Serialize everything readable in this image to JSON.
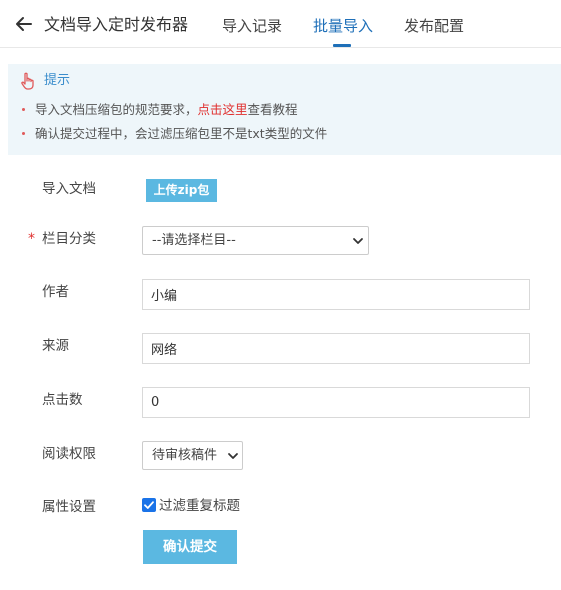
{
  "header": {
    "title": "文档导入定时发布器",
    "tabs": [
      {
        "label": "导入记录",
        "active": false
      },
      {
        "label": "批量导入",
        "active": true
      },
      {
        "label": "发布配置",
        "active": false
      }
    ]
  },
  "tip": {
    "title": "提示",
    "line1_prefix": "导入文档压缩包的规范要求，",
    "line1_link": "点击这里",
    "line1_suffix": "查看教程",
    "line2": "确认提交过程中，会过滤压缩包里不是txt类型的文件"
  },
  "form": {
    "upload_label": "导入文档",
    "upload_button": "上传zip包",
    "required_mark": "*",
    "category_label": "栏目分类",
    "category_value": "--请选择栏目--",
    "author_label": "作者",
    "author_value": "小编",
    "source_label": "来源",
    "source_value": "网络",
    "clicks_label": "点击数",
    "clicks_value": "0",
    "permission_label": "阅读权限",
    "permission_value": "待审核稿件",
    "attr_label": "属性设置",
    "dedupe_label": "过滤重复标题",
    "dedupe_checked": true,
    "submit_label": "确认提交"
  },
  "colors": {
    "accent": "#1e6fb8",
    "button": "#5bb8e1",
    "link_red": "#e0302f",
    "tip_bg": "#eef6fa"
  }
}
